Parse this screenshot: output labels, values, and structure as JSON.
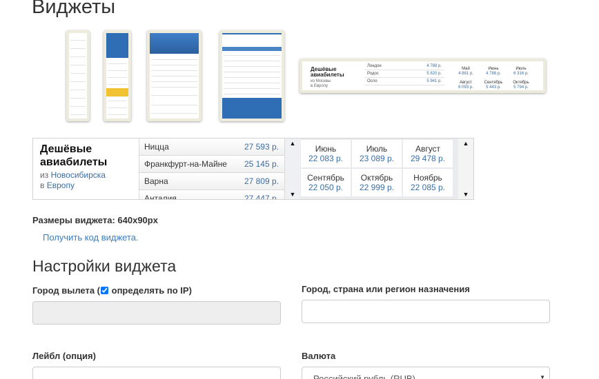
{
  "page": {
    "title": "Виджеты"
  },
  "thumb5": {
    "title_line1": "Дешёвые",
    "title_line2": "авиабилеты",
    "sub_from": "из Москвы",
    "sub_to": "в Европу",
    "rows": [
      {
        "city": "Лондон",
        "price": "4 788 р."
      },
      {
        "city": "Родос",
        "price": "5 820 р."
      },
      {
        "city": "Осло",
        "price": "5 941 р."
      }
    ],
    "cells": [
      {
        "month": "Май",
        "price": "4 881 р."
      },
      {
        "month": "Июнь",
        "price": "4 788 р."
      },
      {
        "month": "Июль",
        "price": "6 316 р."
      },
      {
        "month": "Август",
        "price": "6 093 р."
      },
      {
        "month": "Сентябрь",
        "price": "5 443 р."
      },
      {
        "month": "Октябрь",
        "price": "5 794 р."
      }
    ]
  },
  "preview": {
    "title": "Дешёвые авиабилеты",
    "from_prefix": "из",
    "from_city": "Новосибирска",
    "to_prefix": "в",
    "to_region": "Европу",
    "rows": [
      {
        "city": "Ницца",
        "price": "27 593 р."
      },
      {
        "city": "Франкфурт-на-Майне",
        "price": "25 145 р."
      },
      {
        "city": "Варна",
        "price": "27 809 р."
      },
      {
        "city": "Анталия",
        "price": "27 447 р."
      }
    ],
    "months": [
      {
        "month": "Июнь",
        "price": "22 083 р."
      },
      {
        "month": "Июль",
        "price": "23 089 р."
      },
      {
        "month": "Август",
        "price": "29 478 р."
      },
      {
        "month": "Сентябрь",
        "price": "22 050 р."
      },
      {
        "month": "Октябрь",
        "price": "22 999 р."
      },
      {
        "month": "Ноябрь",
        "price": "22 085 р."
      }
    ],
    "scroll_up_icon": "▲",
    "scroll_down_icon": "▼"
  },
  "size_info": "Размеры виджета: 640x90px",
  "get_code_link": "Получить код виджета.",
  "settings": {
    "title": "Настройки виджета",
    "departure_label_pre": "Город вылета (",
    "departure_label_post": " определять по IP)",
    "departure_checked": true,
    "departure_value": "",
    "destination_label": "Город, страна или регион назначения",
    "destination_value": "",
    "label_label": "Лейбл (опция)",
    "label_value": "",
    "currency_label": "Валюта",
    "currency_value": "Российский рубль (RUB)"
  }
}
